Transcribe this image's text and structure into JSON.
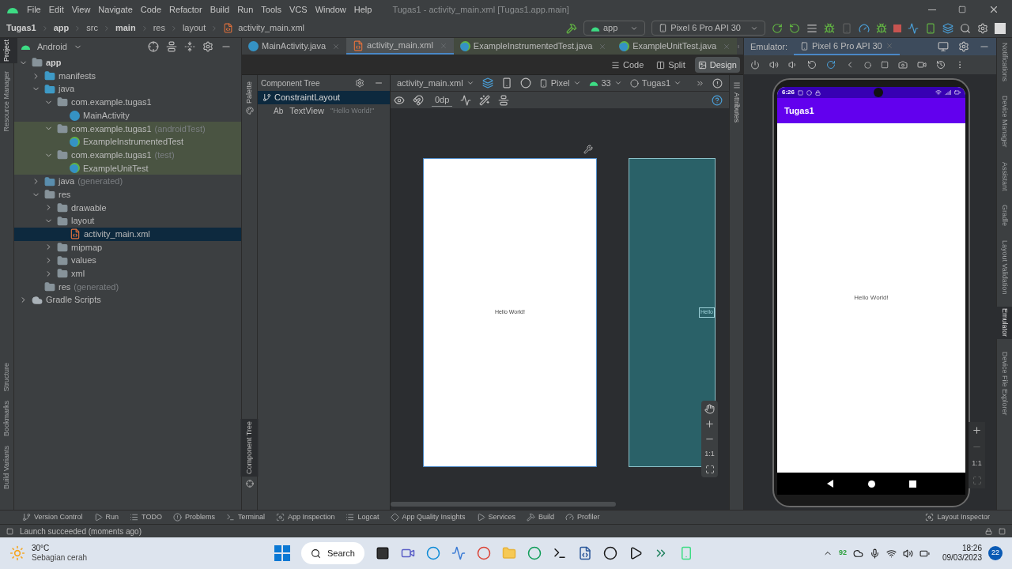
{
  "menu": [
    "File",
    "Edit",
    "View",
    "Navigate",
    "Code",
    "Refactor",
    "Build",
    "Run",
    "Tools",
    "VCS",
    "Window",
    "Help"
  ],
  "window_title": "Tugas1 - activity_main.xml [Tugas1.app.main]",
  "breadcrumb": [
    "Tugas1",
    "app",
    "src",
    "main",
    "res",
    "layout",
    "activity_main.xml"
  ],
  "run_config": "app",
  "device": "Pixel 6 Pro API 30",
  "left_strip": [
    {
      "label": "Project",
      "selected": true
    },
    {
      "label": "Resource Manager",
      "selected": false
    },
    {
      "label": "Structure",
      "selected": false
    },
    {
      "label": "Bookmarks",
      "selected": false
    },
    {
      "label": "Build Variants",
      "selected": false
    }
  ],
  "project": {
    "view": "Android",
    "tree": [
      {
        "name": "app",
        "kind": "module",
        "expanded": true,
        "children": [
          {
            "name": "manifests",
            "kind": "folder",
            "expanded": false
          },
          {
            "name": "java",
            "kind": "folder",
            "expanded": true,
            "children": [
              {
                "name": "com.example.tugas1",
                "kind": "package",
                "expanded": true,
                "highlighted": false,
                "children": [
                  {
                    "name": "MainActivity",
                    "kind": "class",
                    "highlighted": false
                  }
                ]
              },
              {
                "name": "com.example.tugas1",
                "suffix": "(androidTest)",
                "kind": "package",
                "expanded": true,
                "highlighted": true,
                "children": [
                  {
                    "name": "ExampleInstrumentedTest",
                    "kind": "testclass",
                    "highlighted": true
                  }
                ]
              },
              {
                "name": "com.example.tugas1",
                "suffix": "(test)",
                "kind": "package",
                "expanded": true,
                "highlighted": true,
                "children": [
                  {
                    "name": "ExampleUnitTest",
                    "kind": "testclass",
                    "highlighted": true
                  }
                ]
              }
            ]
          },
          {
            "name": "java",
            "suffix": "(generated)",
            "kind": "generated",
            "expanded": false
          },
          {
            "name": "res",
            "kind": "resfolder",
            "expanded": true,
            "children": [
              {
                "name": "drawable",
                "kind": "package",
                "expanded": false
              },
              {
                "name": "layout",
                "kind": "package",
                "expanded": true,
                "children": [
                  {
                    "name": "activity_main.xml",
                    "kind": "xml",
                    "selected": true
                  }
                ]
              },
              {
                "name": "mipmap",
                "kind": "package",
                "expanded": false
              },
              {
                "name": "values",
                "kind": "package",
                "expanded": false
              },
              {
                "name": "xml",
                "kind": "package",
                "expanded": false
              }
            ]
          },
          {
            "name": "res",
            "suffix": "(generated)",
            "kind": "resfolder"
          }
        ]
      },
      {
        "name": "Gradle Scripts",
        "kind": "gradle",
        "expanded": false
      }
    ]
  },
  "editor_tabs": [
    {
      "label": "MainActivity.java",
      "kind": "class",
      "selected": false
    },
    {
      "label": "activity_main.xml",
      "kind": "xml",
      "selected": true
    },
    {
      "label": "ExampleInstrumentedTest.java",
      "kind": "testclass",
      "selected": false
    },
    {
      "label": "ExampleUnitTest.java",
      "kind": "testclass",
      "selected": false
    }
  ],
  "view_modes": [
    {
      "label": "Code",
      "selected": false
    },
    {
      "label": "Split",
      "selected": false
    },
    {
      "label": "Design",
      "selected": true
    }
  ],
  "palette_label": "Palette",
  "component_tree": {
    "title": "Component Tree",
    "strip_label": "Component Tree",
    "items": [
      {
        "name": "ConstraintLayout",
        "selected": true,
        "children": [
          {
            "icon_text": "Ab",
            "name": "TextView",
            "value": "\"Hello World!\"",
            "selected": false
          }
        ]
      }
    ]
  },
  "design_toolbar": {
    "file": "activity_main.xml",
    "device": "Pixel",
    "api": "33",
    "theme": "Tugas1",
    "margin": "0dp"
  },
  "preview": {
    "text": "Hello World!",
    "blueprint_text": "Hello"
  },
  "design_zoom": "1:1",
  "attributes_label": "Attributes",
  "emulator": {
    "label": "Emulator:",
    "tab": "Pixel 6 Pro API 30",
    "phone": {
      "time": "6:26",
      "app_title": "Tugas1",
      "text": "Hello World!"
    },
    "zoom": "1:1"
  },
  "right_strip": [
    {
      "label": "Notifications",
      "selected": false
    },
    {
      "label": "Device Manager",
      "selected": false
    },
    {
      "label": "Assistant",
      "selected": false
    },
    {
      "label": "Gradle",
      "selected": false
    },
    {
      "label": "Layout Validation",
      "selected": false
    },
    {
      "label": "Emulator",
      "selected": true
    },
    {
      "label": "Device File Explorer",
      "selected": false
    }
  ],
  "bottom_tools": [
    {
      "label": "Version Control",
      "kind": "vcs"
    },
    {
      "label": "Run",
      "kind": "run"
    },
    {
      "label": "TODO",
      "kind": "list"
    },
    {
      "label": "Problems",
      "kind": "problems"
    },
    {
      "label": "Terminal",
      "kind": "terminal"
    },
    {
      "label": "App Inspection",
      "kind": "inspect"
    },
    {
      "label": "Logcat",
      "kind": "list"
    },
    {
      "label": "App Quality Insights",
      "kind": "quality"
    },
    {
      "label": "Services",
      "kind": "services"
    },
    {
      "label": "Build",
      "kind": "build"
    },
    {
      "label": "Profiler",
      "kind": "profiler"
    }
  ],
  "layout_inspector": "Layout Inspector",
  "status": "Launch succeeded (moments ago)",
  "taskbar": {
    "temp": "30°C",
    "weather": "Sebagian cerah",
    "search": "Search",
    "tray_count": "92",
    "time": "18:26",
    "date": "09/03/2023",
    "notifications": "22"
  }
}
